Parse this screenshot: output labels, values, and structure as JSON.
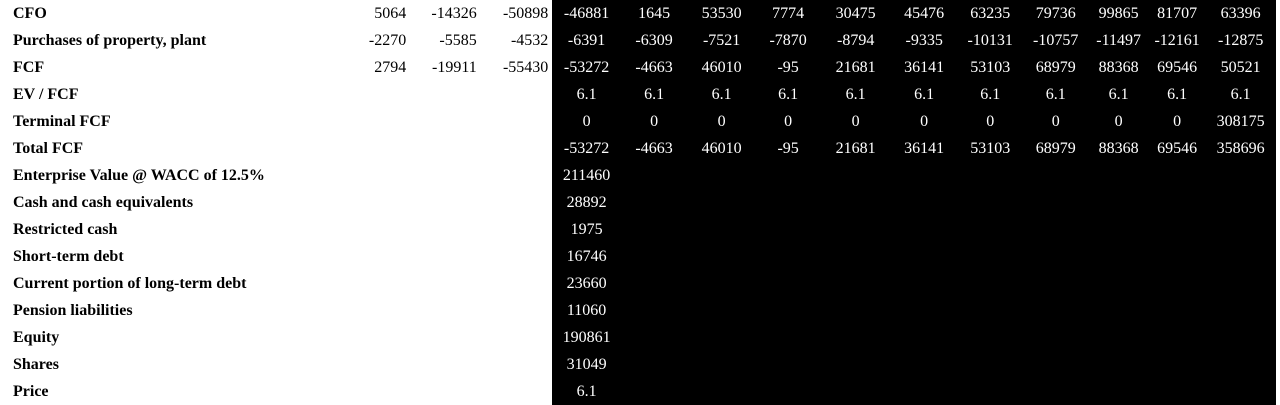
{
  "rows": [
    {
      "label": "CFO",
      "values": [
        "5064",
        "-14326",
        "-50898",
        "-46881",
        "1645",
        "53530",
        "7774",
        "30475",
        "45476",
        "63235",
        "79736",
        "99865",
        "81707",
        "63396"
      ]
    },
    {
      "label": "Purchases of property, plant",
      "values": [
        "-2270",
        "-5585",
        "-4532",
        "-6391",
        "-6309",
        "-7521",
        "-7870",
        "-8794",
        "-9335",
        "-10131",
        "-10757",
        "-11497",
        "-12161",
        "-12875"
      ]
    },
    {
      "label": "FCF",
      "values": [
        "2794",
        "-19911",
        "-55430",
        "-53272",
        "-4663",
        "46010",
        "-95",
        "21681",
        "36141",
        "53103",
        "68979",
        "88368",
        "69546",
        "50521"
      ]
    },
    {
      "label": "EV / FCF",
      "values": [
        "",
        "",
        "",
        "6.1",
        "6.1",
        "6.1",
        "6.1",
        "6.1",
        "6.1",
        "6.1",
        "6.1",
        "6.1",
        "6.1",
        "6.1"
      ]
    },
    {
      "label": "Terminal FCF",
      "values": [
        "",
        "",
        "",
        "0",
        "0",
        "0",
        "0",
        "0",
        "0",
        "0",
        "0",
        "0",
        "0",
        "308175"
      ]
    },
    {
      "label": "Total FCF",
      "values": [
        "",
        "",
        "",
        "-53272",
        "-4663",
        "46010",
        "-95",
        "21681",
        "36141",
        "53103",
        "68979",
        "88368",
        "69546",
        "358696"
      ]
    },
    {
      "label": "Enterprise Value @ WACC of 12.5%",
      "values": [
        "",
        "",
        "",
        "211460",
        "",
        "",
        "",
        "",
        "",
        "",
        "",
        "",
        "",
        ""
      ]
    },
    {
      "label": "Cash and cash equivalents",
      "values": [
        "",
        "",
        "",
        "28892",
        "",
        "",
        "",
        "",
        "",
        "",
        "",
        "",
        "",
        ""
      ]
    },
    {
      "label": "Restricted cash",
      "values": [
        "",
        "",
        "",
        "1975",
        "",
        "",
        "",
        "",
        "",
        "",
        "",
        "",
        "",
        ""
      ]
    },
    {
      "label": "Short-term debt",
      "values": [
        "",
        "",
        "",
        "16746",
        "",
        "",
        "",
        "",
        "",
        "",
        "",
        "",
        "",
        ""
      ]
    },
    {
      "label": "Current portion of long-term debt",
      "values": [
        "",
        "",
        "",
        "23660",
        "",
        "",
        "",
        "",
        "",
        "",
        "",
        "",
        "",
        ""
      ]
    },
    {
      "label": "Pension liabilities",
      "values": [
        "",
        "",
        "",
        "11060",
        "",
        "",
        "",
        "",
        "",
        "",
        "",
        "",
        "",
        ""
      ]
    },
    {
      "label": "Equity",
      "values": [
        "",
        "",
        "",
        "190861",
        "",
        "",
        "",
        "",
        "",
        "",
        "",
        "",
        "",
        ""
      ]
    },
    {
      "label": "Shares",
      "values": [
        "",
        "",
        "",
        "31049",
        "",
        "",
        "",
        "",
        "",
        "",
        "",
        "",
        "",
        ""
      ]
    },
    {
      "label": "Price",
      "values": [
        "",
        "",
        "",
        "6.1",
        "",
        "",
        "",
        "",
        "",
        "",
        "",
        "",
        "",
        ""
      ]
    }
  ],
  "colors": {
    "page_background": "#ffffff",
    "highlight_background": "#000000",
    "highlight_text": "#ffffff",
    "text": "#000000"
  }
}
